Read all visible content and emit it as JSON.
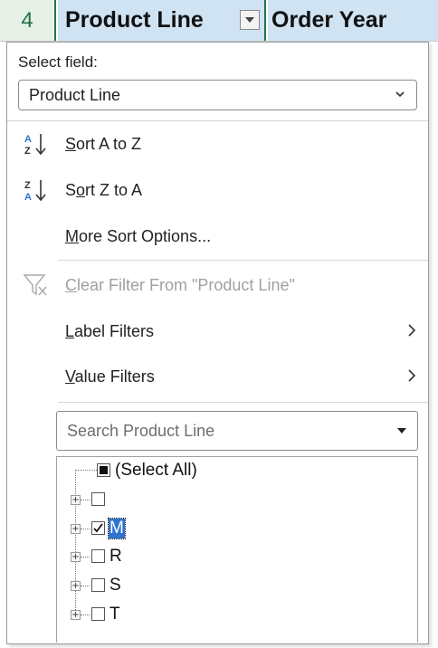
{
  "header": {
    "row_number": "4",
    "col_product_line": "Product Line",
    "col_order_year": "Order Year"
  },
  "filter_menu": {
    "select_field_label": "Select field:",
    "selected_field": "Product Line",
    "sort_a_to_z": {
      "accel": "S",
      "rest": "ort A to Z",
      "icon": "sort-ascending-icon"
    },
    "sort_z_to_a": {
      "pre": "S",
      "accel": "o",
      "rest": "rt Z to A",
      "icon": "sort-descending-icon"
    },
    "more_sort": {
      "accel": "M",
      "rest": "ore Sort Options..."
    },
    "clear_filter": {
      "accel": "C",
      "rest": "lear Filter From \"Product Line\"",
      "icon": "clear-filter-icon"
    },
    "label_filters": {
      "accel": "L",
      "rest": "abel Filters"
    },
    "value_filters": {
      "accel": "V",
      "rest": "alue Filters"
    },
    "search_placeholder": "Search Product Line",
    "items": [
      {
        "label": "(Select All)",
        "state": "indeterminate"
      },
      {
        "label": "",
        "state": "unchecked"
      },
      {
        "label": "M",
        "state": "checked"
      },
      {
        "label": "R",
        "state": "unchecked"
      },
      {
        "label": "S",
        "state": "unchecked"
      },
      {
        "label": "T",
        "state": "unchecked"
      }
    ]
  },
  "colors": {
    "header_fill": "#cfe3f3",
    "excel_green": "#217346",
    "selection_blue": "#2f73d0"
  }
}
